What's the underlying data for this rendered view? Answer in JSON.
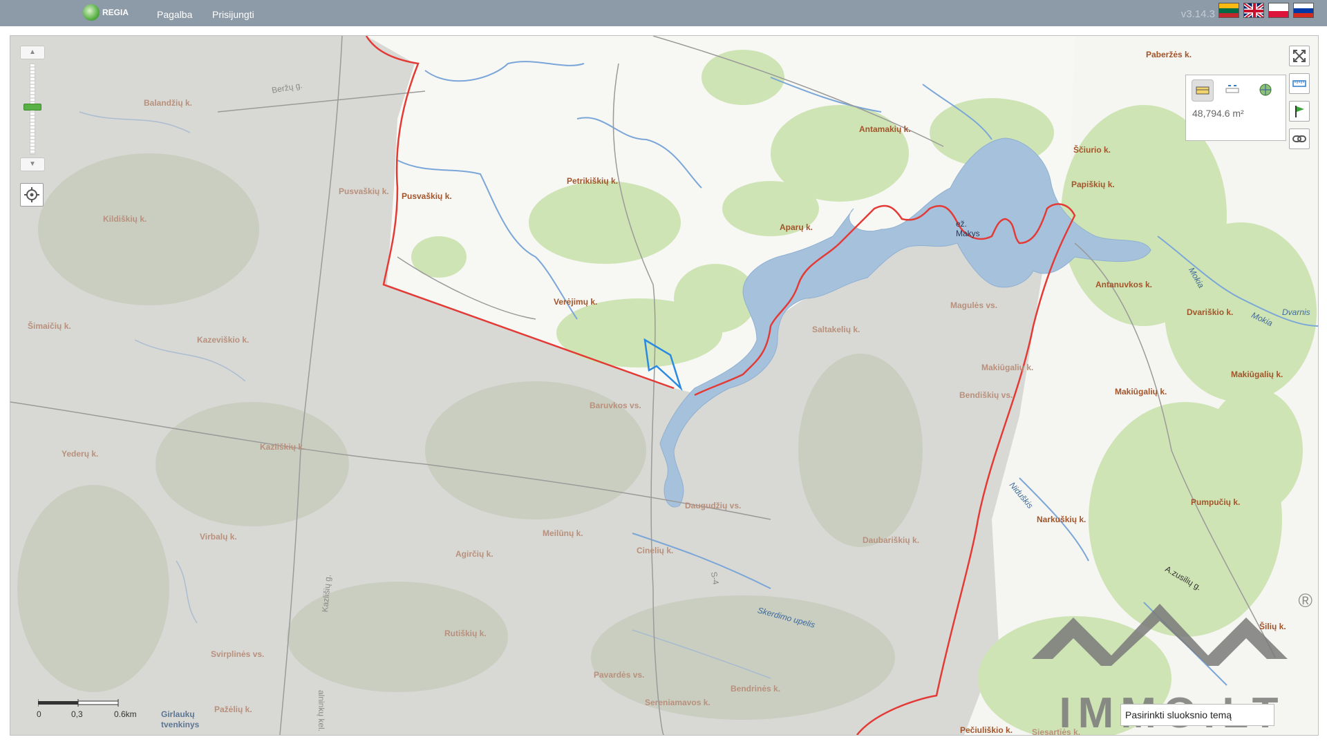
{
  "header": {
    "logo_text": "REGIA",
    "nav": [
      "Pagalba",
      "Prisijungti"
    ],
    "version": "v3.14.3",
    "flags": [
      "lithuanian-flag",
      "uk-flag",
      "polish-flag",
      "russian-flag"
    ]
  },
  "map": {
    "measure_panel": {
      "area": "48,794.6 m²"
    },
    "scale": {
      "ticks": [
        "0",
        "0,3",
        "0.6km"
      ]
    },
    "layer_input": "Pasirinkti sluoksnio temą",
    "watermark": "IMMO.LT",
    "watermark_symbol": "®",
    "lake": {
      "prefix": "ež.",
      "name": "Makys"
    },
    "villages": [
      "Paberžės k.",
      "Antamakių k.",
      "Ščiurio k.",
      "Papiškių k.",
      "Petrikiškių k.",
      "Pusvaškių k.",
      "Aparų k.",
      "Verėjimų k.",
      "Antanuvkos k.",
      "Dvariškio k.",
      "Makiūgalių k.",
      "Makiūgalių k.",
      "Pumpučių k.",
      "Narkuškių k.",
      "Pečiuliškio k.",
      "Balandžių k.",
      "Kildiškių k.",
      "Šimaičių k.",
      "Kazeviškio k.",
      "Yederų k.",
      "Kazliškių k.",
      "Virbalų k.",
      "Svirplinės vs.",
      "Pažėlių k.",
      "Rutiškių k.",
      "Pavardės vs.",
      "Agirčių k.",
      "Meilūnų k.",
      "Cinelių k.",
      "Baruvkos vs.",
      "Daugudžių vs.",
      "Daubariškių k.",
      "Bendiškių vs.",
      "Makiūgalių k.",
      "Saltakelių k.",
      "Magulės vs.",
      "Bendrinės k.",
      "Sereniamavos k.",
      "Siesartiės k.",
      "Pusvaškių k.",
      "Šilių k."
    ],
    "water_labels": [
      "Girlaukų",
      "tvenkinys",
      "Mokia",
      "Mokia",
      "Dvarnis",
      "Skerdimo upelis",
      "Niduškis"
    ],
    "road_labels": [
      "Beržų g.",
      "Kazlišių g.",
      "A.zusilių g.",
      "S-4",
      "alninkų kel."
    ]
  }
}
